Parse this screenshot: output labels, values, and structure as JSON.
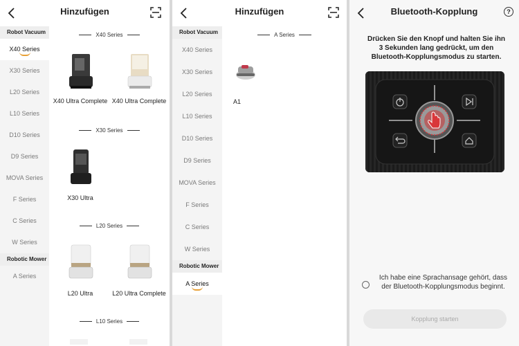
{
  "screen1": {
    "title": "Hinzufügen",
    "sidebar": [
      {
        "type": "group",
        "label": "Robot Vacuum"
      },
      {
        "type": "item",
        "label": "X40 Series",
        "active": true
      },
      {
        "type": "item",
        "label": "X30 Series"
      },
      {
        "type": "item",
        "label": "L20 Series"
      },
      {
        "type": "item",
        "label": "L10 Series"
      },
      {
        "type": "item",
        "label": "D10 Series"
      },
      {
        "type": "item",
        "label": "D9 Series"
      },
      {
        "type": "item",
        "label": "MOVA Series"
      },
      {
        "type": "item",
        "label": "F Series"
      },
      {
        "type": "item",
        "label": "C Series"
      },
      {
        "type": "item",
        "label": "W Series"
      },
      {
        "type": "group",
        "label": "Robotic Mower"
      },
      {
        "type": "item",
        "label": "A Series"
      }
    ],
    "sections": [
      {
        "label": "X40 Series",
        "products": [
          "X40 Ultra Complete",
          "X40 Ultra Complete"
        ]
      },
      {
        "label": "X30 Series",
        "products": [
          "X30 Ultra"
        ]
      },
      {
        "label": "L20 Series",
        "products": [
          "L20 Ultra",
          "L20 Ultra Complete"
        ]
      },
      {
        "label": "L10 Series",
        "products": []
      }
    ]
  },
  "screen2": {
    "title": "Hinzufügen",
    "sidebar": [
      {
        "type": "group",
        "label": "Robot Vacuum"
      },
      {
        "type": "item",
        "label": "X40 Series"
      },
      {
        "type": "item",
        "label": "X30 Series"
      },
      {
        "type": "item",
        "label": "L20 Series"
      },
      {
        "type": "item",
        "label": "L10 Series"
      },
      {
        "type": "item",
        "label": "D10 Series"
      },
      {
        "type": "item",
        "label": "D9 Series"
      },
      {
        "type": "item",
        "label": "MOVA Series"
      },
      {
        "type": "item",
        "label": "F Series"
      },
      {
        "type": "item",
        "label": "C Series"
      },
      {
        "type": "item",
        "label": "W Series"
      },
      {
        "type": "group",
        "label": "Robotic Mower"
      },
      {
        "type": "item",
        "label": "A Series",
        "active": true
      }
    ],
    "section": {
      "label": "A Series",
      "product": "A1"
    }
  },
  "screen3": {
    "title": "Bluetooth-Kopplung",
    "help_label": "?",
    "instruction": "Drücken Sie den Knopf und halten Sie ihn 3 Sekunden lang gedrückt, um den Bluetooth-Kopplungsmodus zu starten.",
    "confirm_text": "Ich habe eine Sprachansage gehört, dass der Bluetooth-Kopplungsmodus beginnt.",
    "start_button": "Kopplung starten"
  },
  "colors": {
    "accent": "#e8a036",
    "press_highlight": "#d9373a",
    "sidebar_bg": "#f4f4f4",
    "disabled_button": "#e9e9e9"
  },
  "icons": [
    "back-chevron-icon",
    "scan-icon",
    "help-icon",
    "power-icon",
    "play-skip-icon",
    "return-home-icon",
    "dock-home-icon",
    "hand-press-icon"
  ]
}
